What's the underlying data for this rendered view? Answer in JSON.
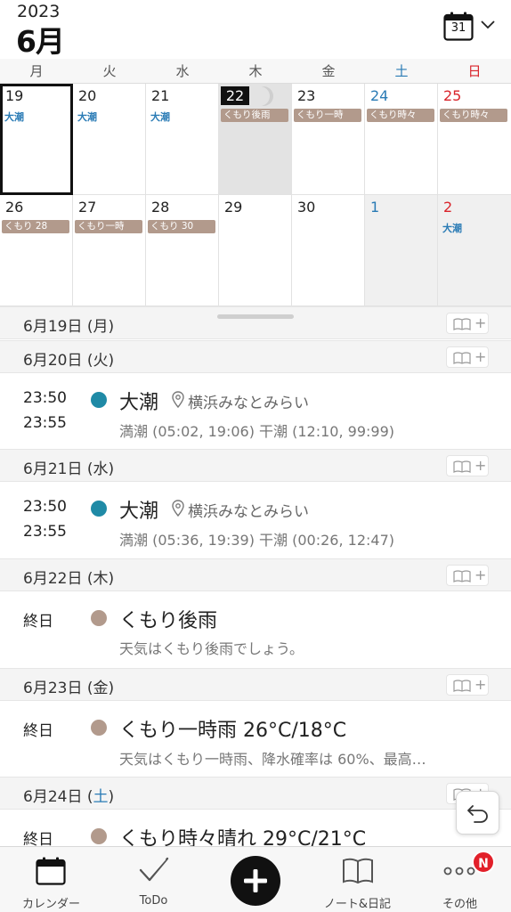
{
  "header": {
    "year": "2023",
    "month": "6月",
    "calendar_icon_day": "31"
  },
  "weekdays": [
    "月",
    "火",
    "水",
    "木",
    "金",
    "土",
    "日"
  ],
  "grid": {
    "row0": [
      {
        "day": "19",
        "tide": "大潮",
        "weather": ""
      },
      {
        "day": "20",
        "tide": "大潮",
        "weather": ""
      },
      {
        "day": "21",
        "tide": "大潮",
        "weather": ""
      },
      {
        "day": "22",
        "tide": "",
        "weather": "くもり後雨"
      },
      {
        "day": "23",
        "tide": "",
        "weather": "くもり一時"
      },
      {
        "day": "24",
        "tide": "",
        "weather": "くもり時々"
      },
      {
        "day": "25",
        "tide": "",
        "weather": "くもり時々"
      }
    ],
    "row1": [
      {
        "day": "26",
        "tide": "",
        "weather": "くもり 28"
      },
      {
        "day": "27",
        "tide": "",
        "weather": "くもり一時"
      },
      {
        "day": "28",
        "tide": "",
        "weather": "くもり 30"
      },
      {
        "day": "29",
        "tide": "",
        "weather": ""
      },
      {
        "day": "30",
        "tide": "",
        "weather": ""
      },
      {
        "day": "1",
        "tide": "",
        "weather": ""
      },
      {
        "day": "2",
        "tide": "大潮",
        "weather": ""
      }
    ]
  },
  "agenda": {
    "d19": {
      "label": "6月19日 (月)"
    },
    "d20": {
      "label": "6月20日 (火)",
      "event": {
        "start": "23:50",
        "end": "23:55",
        "title": "大潮",
        "location": "横浜みなとみらい",
        "detail": "満潮 (05:02, 19:06) 干潮 (12:10, 99:99)"
      }
    },
    "d21": {
      "label": "6月21日 (水)",
      "event": {
        "start": "23:50",
        "end": "23:55",
        "title": "大潮",
        "location": "横浜みなとみらい",
        "detail": "満潮 (05:36, 19:39) 干潮 (00:26, 12:47)"
      }
    },
    "d22": {
      "label": "6月22日 (木)",
      "event": {
        "start": "終日",
        "title": "くもり後雨",
        "detail": "天気はくもり後雨でしょう。"
      }
    },
    "d23": {
      "label": "6月23日 (金)",
      "event": {
        "start": "終日",
        "title": "くもり一時雨 26°C/18°C",
        "detail": "天気はくもり一時雨、降水確率は 60%、最高…"
      }
    },
    "d24": {
      "label_prefix": "6月24日 (",
      "label_day": "土",
      "label_suffix": ")",
      "event": {
        "start": "終日",
        "title": "くもり時々晴れ 29°C/21°C"
      }
    }
  },
  "tabs": {
    "calendar": "カレンダー",
    "todo": "ToDo",
    "notes": "ノート&日記",
    "more": "その他",
    "more_badge": "N"
  },
  "colors": {
    "tide_dot": "#1f8aa6",
    "weather_dot": "#b29a8c",
    "saturday": "#2a7bb5",
    "sunday": "#d9232a"
  }
}
